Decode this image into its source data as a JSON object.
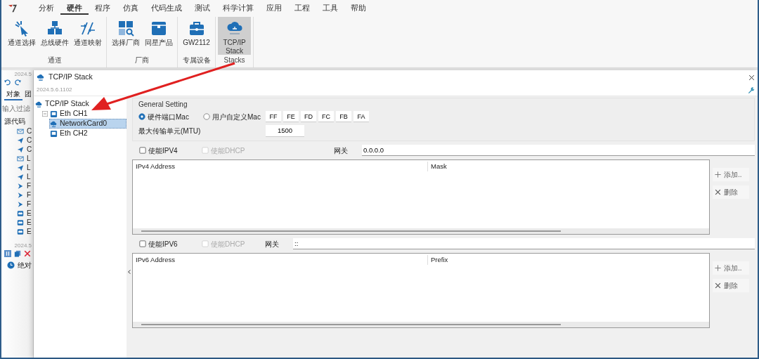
{
  "menu": [
    {
      "label": "分析",
      "selected": false
    },
    {
      "label": "硬件",
      "selected": true
    },
    {
      "label": "程序",
      "selected": false
    },
    {
      "label": "仿真",
      "selected": false
    },
    {
      "label": "代码生成",
      "selected": false
    },
    {
      "label": "测试",
      "selected": false
    },
    {
      "label": "科学计算",
      "selected": false
    },
    {
      "label": "应用",
      "selected": false
    },
    {
      "label": "工程",
      "selected": false
    },
    {
      "label": "工具",
      "selected": false
    },
    {
      "label": "帮助",
      "selected": false
    }
  ],
  "ribbon": [
    {
      "label": "通道",
      "buttons": [
        {
          "label": "通道选择",
          "selected": false
        },
        {
          "label": "总线硬件",
          "selected": false
        },
        {
          "label": "通道映射",
          "selected": false
        }
      ]
    },
    {
      "label": "厂商",
      "buttons": [
        {
          "label": "选择厂商",
          "selected": false
        },
        {
          "label": "同星产品",
          "selected": false
        }
      ]
    },
    {
      "label": "专属设备",
      "buttons": [
        {
          "label": "GW2112",
          "selected": false
        }
      ]
    },
    {
      "label": "Stacks",
      "buttons": [
        {
          "label": "TCP/IP Stack",
          "selected": true
        }
      ]
    }
  ],
  "side_panel": {
    "version": "2024.5",
    "tabs": [
      {
        "label": "对象",
        "selected": true
      },
      {
        "label": "团",
        "selected": false
      }
    ],
    "filter_placeholder": "输入过滤",
    "tree_root": "源代码",
    "items": [
      "C",
      "C",
      "C",
      "L",
      "L",
      "L",
      "F",
      "F",
      "F",
      "E",
      "E",
      "E"
    ],
    "version_2": "2024.5",
    "clock_item": "绝对"
  },
  "dialog": {
    "title": "TCP/IP Stack",
    "version": "2024.5.6.1102",
    "tree": [
      {
        "label": "TCP/IP Stack",
        "selected": false,
        "children": [
          {
            "label": "Eth CH1",
            "expanded": true,
            "selected": false,
            "children": [
              {
                "label": "NetworkCard0",
                "selected": true
              }
            ]
          },
          {
            "label": "Eth CH2",
            "selected": false
          }
        ]
      }
    ],
    "general": {
      "legend": "General Setting",
      "mac_modes": [
        {
          "label": "硬件端口Mac",
          "selected": true
        },
        {
          "label": "用户自定义Mac",
          "selected": false
        }
      ],
      "mac_bytes": [
        "FF",
        "FE",
        "FD",
        "FC",
        "FB",
        "FA"
      ],
      "mtu_label": "最大传输单元(MTU)",
      "mtu": "1500"
    },
    "sections": [
      {
        "enable_label": "使能IPV4",
        "enabled": false,
        "dhcp_label": "使能DHCP",
        "dhcp_checked": false,
        "dhcp_disabled": true,
        "gateway_label": "网关",
        "gateway": "0.0.0.0",
        "columns": [
          "IPv4 Address",
          "Mask"
        ],
        "actions": [
          "添加..",
          "删除"
        ]
      },
      {
        "enable_label": "使能IPV6",
        "enabled": false,
        "dhcp_label": "使能DHCP",
        "dhcp_checked": false,
        "dhcp_disabled": true,
        "gateway_label": "网关",
        "gateway": "::",
        "columns": [
          "IPv6 Address",
          "Prefix"
        ],
        "actions": [
          "添加..",
          "删除"
        ]
      }
    ]
  }
}
